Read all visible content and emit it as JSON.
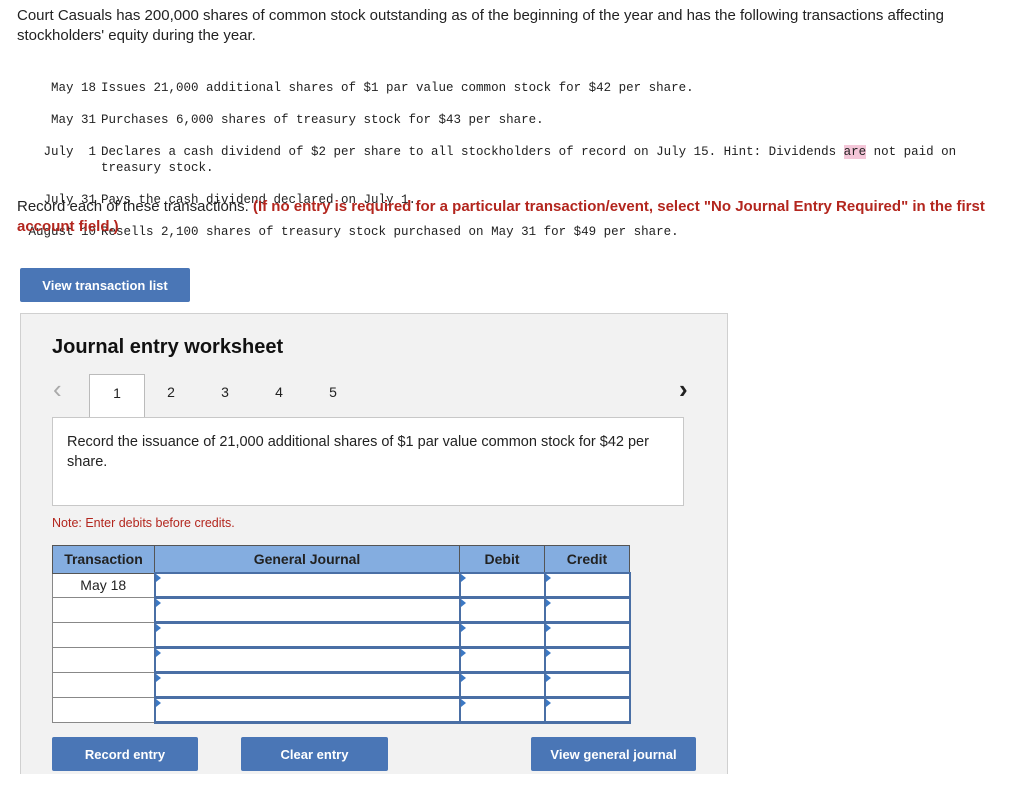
{
  "intro": "Court Casuals has 200,000 shares of common stock outstanding as of the beginning of the year and has the following transactions affecting stockholders' equity during the year.",
  "transactions": [
    {
      "date": "May 18",
      "text": "Issues 21,000 additional shares of $1 par value common stock for $42 per share."
    },
    {
      "date": "May 31",
      "text": "Purchases 6,000 shares of treasury stock for $43 per share."
    },
    {
      "date": "July  1",
      "text_a": "Declares a cash dividend of $2 per share to all stockholders of record on July 15. Hint: Dividends ",
      "highlight": "are",
      "text_b": " not paid on treasury stock."
    },
    {
      "date": "July 31",
      "text": "Pays the cash dividend declared on July 1."
    },
    {
      "date": "August 10",
      "text": "Resells 2,100 shares of treasury stock purchased on May 31 for $49 per share."
    }
  ],
  "instruction": "Record each of these transactions.",
  "instruction_bold": "(If no entry is required for a particular transaction/event, select \"No Journal Entry Required\" in the first account field.)",
  "view_list": "View transaction list",
  "worksheet": {
    "title": "Journal entry worksheet",
    "tabs": [
      "1",
      "2",
      "3",
      "4",
      "5"
    ],
    "active_tab": "1",
    "prev": "‹",
    "next": "›",
    "question": "Record the issuance of 21,000 additional shares of $1 par value common stock for $42 per share.",
    "note": "Note: Enter debits before credits.",
    "columns": [
      "Transaction",
      "General Journal",
      "Debit",
      "Credit"
    ],
    "rows": [
      {
        "transaction": "May 18"
      },
      {
        "transaction": ""
      },
      {
        "transaction": ""
      },
      {
        "transaction": ""
      },
      {
        "transaction": ""
      },
      {
        "transaction": ""
      }
    ],
    "record": "Record entry",
    "clear": "Clear entry",
    "view_journal": "View general journal"
  },
  "colors": {
    "button": "#4a76b6",
    "header": "#84ade0",
    "accent_red": "#b3261e"
  }
}
